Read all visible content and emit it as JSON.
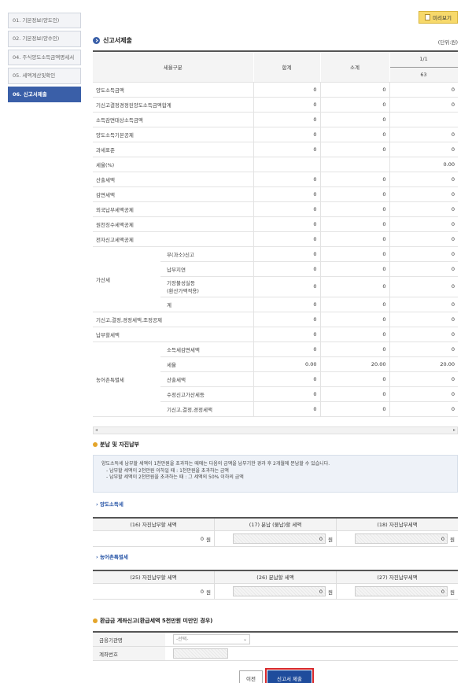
{
  "sidebar": {
    "items": [
      {
        "label": "01. 기본정보(양도인)"
      },
      {
        "label": "02. 기본정보(양수인)"
      },
      {
        "label": "04. 주식양도소득금액명세서"
      },
      {
        "label": "05. 세액계산및확인"
      },
      {
        "label": "06. 신고서제출"
      }
    ]
  },
  "toolbar": {
    "preview_label": "미리보기"
  },
  "section": {
    "title": "신고서제출",
    "unit": "(단위:원)"
  },
  "table": {
    "header": {
      "category": "세율구분",
      "total": "합계",
      "subtotal": "소계",
      "page": "1/1",
      "rate": "63"
    },
    "rows": [
      {
        "label": "양도소득금액",
        "total": "0",
        "subtotal": "0",
        "col": "0"
      },
      {
        "label": "기신고결정경정된양도소득금액합계",
        "total": "0",
        "subtotal": "0",
        "col": "0"
      },
      {
        "label": "소득감면대상소득금액",
        "total": "0",
        "subtotal": "0",
        "col": ""
      },
      {
        "label": "양도소득기본공제",
        "total": "0",
        "subtotal": "0",
        "col": "0"
      },
      {
        "label": "과세표준",
        "total": "0",
        "subtotal": "0",
        "col": "0"
      },
      {
        "label": "세율(%)",
        "total": "",
        "subtotal": "",
        "col": "0.00"
      },
      {
        "label": "산출세액",
        "total": "0",
        "subtotal": "0",
        "col": "0"
      },
      {
        "label": "감면세액",
        "total": "0",
        "subtotal": "0",
        "col": "0"
      },
      {
        "label": "외국납부세액공제",
        "total": "0",
        "subtotal": "0",
        "col": "0"
      },
      {
        "label": "원천징수세액공제",
        "total": "0",
        "subtotal": "0",
        "col": "0"
      },
      {
        "label": "전자신고세액공제",
        "total": "0",
        "subtotal": "0",
        "col": "0"
      }
    ],
    "penalty": {
      "label": "가산세",
      "rows": [
        {
          "label": "무(과소)신고",
          "total": "0",
          "subtotal": "0",
          "col": "0"
        },
        {
          "label": "납부지연",
          "total": "0",
          "subtotal": "0",
          "col": "0"
        },
        {
          "label": "기장불성실등",
          "label2": "(환산가액적용)",
          "total": "0",
          "subtotal": "0",
          "col": "0"
        },
        {
          "label": "계",
          "total": "0",
          "subtotal": "0",
          "col": "0"
        }
      ]
    },
    "rows2": [
      {
        "label": "기신고,결정,경정세액,조정공제",
        "total": "0",
        "subtotal": "0",
        "col": "0"
      },
      {
        "label": "납부할세액",
        "total": "0",
        "subtotal": "0",
        "col": "0"
      }
    ],
    "rural": {
      "label": "농어촌특별세",
      "rows": [
        {
          "label": "소득세감면세액",
          "total": "0",
          "subtotal": "0",
          "col": "0"
        },
        {
          "label": "세율",
          "total": "0.00",
          "subtotal": "20.00",
          "col": "20.00"
        },
        {
          "label": "산출세액",
          "total": "0",
          "subtotal": "0",
          "col": "0"
        },
        {
          "label": "수정신고가산세등",
          "total": "0",
          "subtotal": "0",
          "col": "0"
        },
        {
          "label": "기신고,결정,경정세액",
          "total": "0",
          "subtotal": "0",
          "col": "0"
        }
      ]
    }
  },
  "installment": {
    "title": "분납 및 자진납부",
    "notes": [
      "양도소득세 납부할 세액이 1천만원을 초과하는 때에는 다음의 금액을 납부기한 경과 후 2개월에 분납할 수 있습니다.",
      "- 납부할 세액이 2천만원 이하일 때 : 1천만원을 초과하는 금액",
      "- 납부할 세액이 2천만원을 초과하는 때 : 그 세액의 50% 이하의 금액"
    ],
    "transfer": {
      "title": "양도소득세",
      "headers": [
        "(16) 자진납부할 세액",
        "(17) 분납 (물납)할 세액",
        "(18) 자진납부세액"
      ],
      "values": [
        "0",
        "0",
        "0"
      ],
      "unit": "원"
    },
    "rural": {
      "title": "농어촌특별세",
      "headers": [
        "(25) 자진납부할 세액",
        "(26) 분납할 세액",
        "(27) 자진납부세액"
      ],
      "values": [
        "0",
        "0",
        "0"
      ],
      "unit": "원"
    }
  },
  "refund": {
    "title": "환급금 계좌신고(환급세액 5천만원 미만인 경우)",
    "bank_label": "금융기관명",
    "bank_placeholder": "-선택-",
    "account_label": "계좌번호"
  },
  "buttons": {
    "prev": "이전",
    "submit": "신고서 제출"
  },
  "colors": {
    "accent": "#1f4c9c",
    "highlight": "#d6262a",
    "preview": "#f7d96b"
  }
}
